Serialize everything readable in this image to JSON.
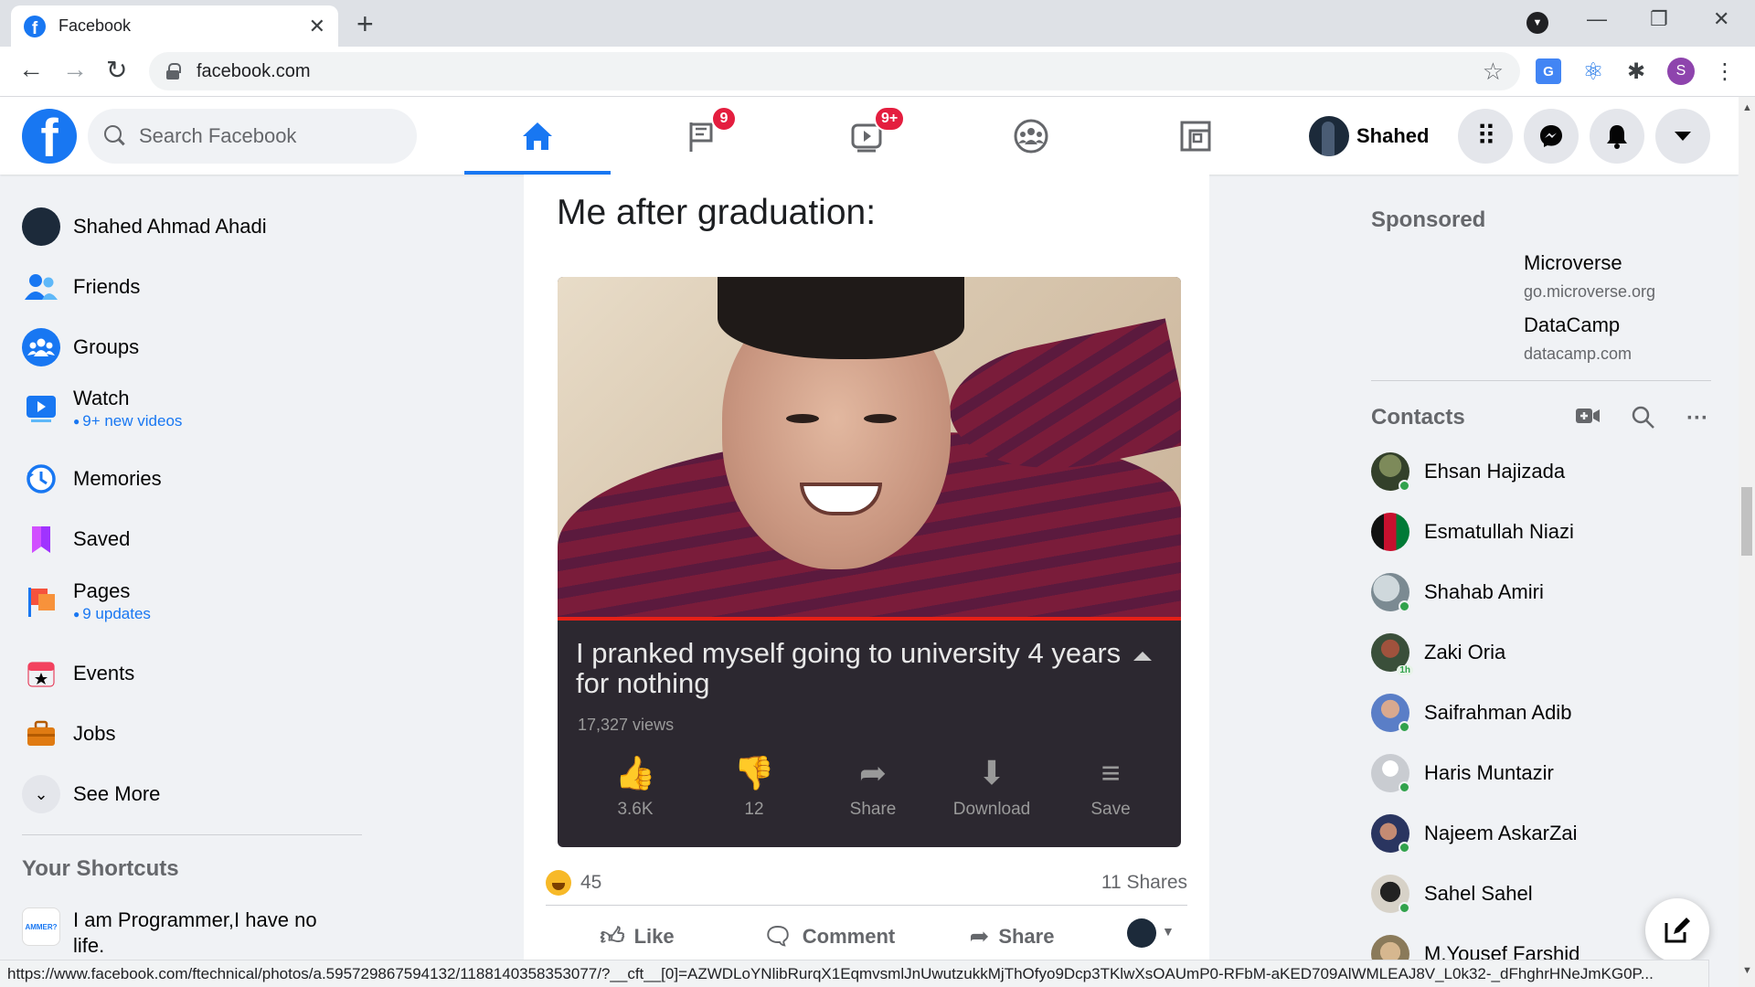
{
  "browser": {
    "tab_title": "Facebook",
    "url": "facebook.com",
    "status_url": "https://www.facebook.com/ftechnical/photos/a.595729867594132/1188140358353077/?__cft__[0]=AZWDLoYNlibRurqX1EqmvsmlJnUwutzukkMjThOfyo9Dcp3TKlwXsOAUmP0-RFbM-aKED709AlWMLEAJ8V_L0k32-_dFhghrHNeJmKG0P...",
    "profile_initial": "S"
  },
  "header": {
    "search_placeholder": "Search Facebook",
    "pages_badge": "9",
    "watch_badge": "9+",
    "user_name": "Shahed"
  },
  "left_nav": {
    "profile_name": "Shahed Ahmad Ahadi",
    "friends": "Friends",
    "groups": "Groups",
    "watch": "Watch",
    "watch_sub": "9+ new videos",
    "memories": "Memories",
    "saved": "Saved",
    "pages": "Pages",
    "pages_sub": "9 updates",
    "events": "Events",
    "jobs": "Jobs",
    "see_more": "See More",
    "shortcuts_heading": "Your Shortcuts",
    "shortcut_1": "I am Programmer,I have no life.",
    "shortcut_1_thumb": "AMMER?"
  },
  "post": {
    "text": "Me after graduation:",
    "meme": {
      "video_title": "I pranked myself going to university 4 years for nothing",
      "views": "17,327 views",
      "likes": "3.6K",
      "dislikes": "12",
      "share": "Share",
      "download": "Download",
      "save": "Save"
    },
    "reaction_count": "45",
    "shares": "11 Shares",
    "like": "Like",
    "comment": "Comment",
    "share": "Share"
  },
  "right": {
    "sponsored_heading": "Sponsored",
    "ads": [
      {
        "name": "Microverse",
        "url": "go.microverse.org"
      },
      {
        "name": "DataCamp",
        "url": "datacamp.com"
      }
    ],
    "contacts_heading": "Contacts",
    "contacts": [
      {
        "name": "Ehsan Hajizada",
        "online": true
      },
      {
        "name": "Esmatullah Niazi",
        "online": false
      },
      {
        "name": "Shahab Amiri",
        "online": true
      },
      {
        "name": "Zaki Oria",
        "online": false,
        "time": "1h"
      },
      {
        "name": "Saifrahman Adib",
        "online": true
      },
      {
        "name": "Haris Muntazir",
        "online": true
      },
      {
        "name": "Najeem AskarZai",
        "online": true
      },
      {
        "name": "Sahel Sahel",
        "online": true
      },
      {
        "name": "M.Yousef Farshid",
        "online": false
      }
    ]
  },
  "colors": {
    "fb_blue": "#1877f2",
    "badge_red": "#e41e3f",
    "online_green": "#31a24c"
  }
}
